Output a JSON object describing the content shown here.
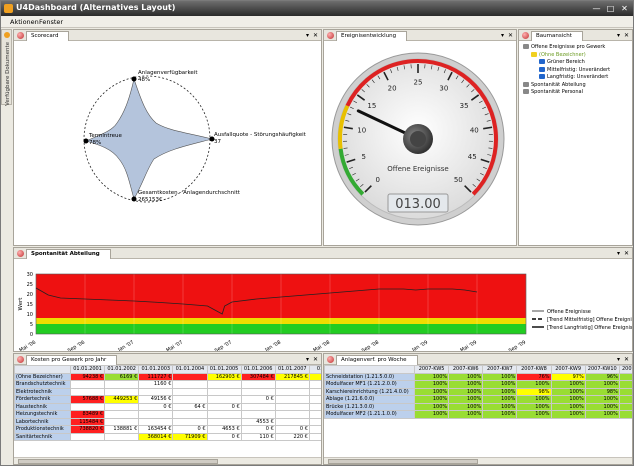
{
  "window": {
    "title": "U4Dashboard (Alternatives Layout)"
  },
  "menu": [
    "Aktionen",
    "Fenster"
  ],
  "sidetab": {
    "label": "Verfügbare Dokumente"
  },
  "scorecard": {
    "tab": "Scorecard",
    "labels": [
      {
        "name": "Anlagenverfügbarkeit",
        "value": "48%"
      },
      {
        "name": "Ausfallquote - Störungshäufigkeit",
        "value": "37"
      },
      {
        "name": "Gesamtkosten - Anlagendurchschnitt",
        "value": "265153€"
      },
      {
        "name": "Termintreue",
        "value": "78%"
      }
    ]
  },
  "gauge": {
    "tab": "Ereignisentwicklung",
    "label": "Offene Ereignisse",
    "readout": "013.00",
    "ticks": [
      "0",
      "5",
      "10",
      "15",
      "20",
      "25",
      "30",
      "35",
      "40",
      "45",
      "50"
    ],
    "value": 13,
    "min": 0,
    "max": 50,
    "colors": {
      "green": "#33aa33",
      "yellow": "#e8c000",
      "red": "#dd2222"
    }
  },
  "tree": {
    "tab": "Baumansicht",
    "items": [
      {
        "label": "Offene Ereignisse pro Gewerk",
        "level": 0
      },
      {
        "label": "(Ohne Bezeichner)",
        "level": 1,
        "selected": true
      },
      {
        "label": "Grüner Bereich",
        "level": 2
      },
      {
        "label": "Mittelfristig: Unverändert",
        "level": 2
      },
      {
        "label": "Langfristig: Unverändert",
        "level": 2
      },
      {
        "label": "Spontanität Abteilung",
        "level": 0
      },
      {
        "label": "Spontanität Personal",
        "level": 0
      }
    ]
  },
  "spontan": {
    "tab": "Spontanität Abteilung",
    "legend": [
      "Offene Ereignisse",
      "[Trend Mittelfristig] Offene Ereignisse",
      "[Trend Langfristig] Offene Ereignisse"
    ]
  },
  "chart_data": {
    "type": "line",
    "ylabel": "Wert",
    "ylim": [
      0,
      30
    ],
    "yticks": [
      "0",
      "5",
      "10",
      "15",
      "20",
      "25",
      "30"
    ],
    "categories": [
      "Mai '06",
      "Jul '06",
      "Sep '06",
      "Nov '06",
      "Jan '07",
      "Mär '07",
      "Mai '07",
      "Jul '07",
      "Sep '07",
      "Nov '07",
      "Jan '08",
      "Mär '08",
      "Mai '08",
      "Jul '08",
      "Sep '08",
      "Nov '08",
      "Jan '09",
      "Mär '09",
      "Mai '09",
      "Jul '09",
      "Sep '09"
    ],
    "bands": [
      {
        "from": 0,
        "to": 5,
        "color": "#22cc22"
      },
      {
        "from": 5,
        "to": 8,
        "color": "#eedd00"
      },
      {
        "from": 8,
        "to": 30,
        "color": "#ee1111"
      }
    ],
    "series": [
      {
        "name": "Offene Ereignisse",
        "x": [
          0,
          0.5,
          1,
          2,
          3,
          4,
          5,
          6,
          7,
          7.6,
          7.7,
          8,
          9,
          10,
          11,
          12,
          13,
          14,
          15,
          15.5,
          16,
          17,
          17.5,
          18
        ],
        "values": [
          23,
          19.5,
          18,
          17.5,
          17,
          16.5,
          15.8,
          15,
          14,
          10,
          14,
          16,
          17.5,
          18.5,
          19.5,
          20.5,
          21.5,
          22.5,
          22.5,
          22,
          22.5,
          22.5,
          22,
          21
        ]
      }
    ]
  },
  "kosten": {
    "tab": "Kosten pro Gewerk pro Jahr",
    "columns": [
      "01.01.2001",
      "01.01.2002",
      "01.01.2003",
      "01.01.2004",
      "01.01.2005",
      "01.01.2006",
      "01.01.2007",
      "01.01.2"
    ],
    "rows": [
      {
        "label": "(Ohne Bezeichner)",
        "cells": [
          [
            "94238 €",
            "r"
          ],
          [
            "6169 €",
            "g"
          ],
          [
            "111727 €",
            "r"
          ],
          [
            "",
            "r"
          ],
          [
            "162903 €",
            "y"
          ],
          [
            "307484 €",
            "r"
          ],
          [
            "217845 €",
            "y"
          ],
          [
            "2 3",
            "y"
          ]
        ]
      },
      {
        "label": "Brandschutztechnik",
        "cells": [
          [
            "",
            "w"
          ],
          [
            "",
            "w"
          ],
          [
            "1160 €",
            "w"
          ],
          [
            "",
            "w"
          ],
          [
            "",
            "w"
          ],
          [
            "",
            "w"
          ],
          [
            "",
            "w"
          ],
          [
            "",
            "w"
          ]
        ]
      },
      {
        "label": "Elektrotechnik",
        "cells": [
          [
            "",
            "w"
          ],
          [
            "",
            "w"
          ],
          [
            "",
            "w"
          ],
          [
            "",
            "w"
          ],
          [
            "",
            "w"
          ],
          [
            "",
            "w"
          ],
          [
            "",
            "w"
          ],
          [
            "",
            "w"
          ]
        ]
      },
      {
        "label": "Fördertechnik",
        "cells": [
          [
            "57688 €",
            "r"
          ],
          [
            "449253 €",
            "y"
          ],
          [
            "49156 €",
            "w"
          ],
          [
            "",
            "w"
          ],
          [
            "",
            "w"
          ],
          [
            "0 €",
            "w"
          ],
          [
            "",
            "w"
          ],
          [
            "",
            "w"
          ]
        ]
      },
      {
        "label": "Haustechnik",
        "cells": [
          [
            "",
            "w"
          ],
          [
            "",
            "w"
          ],
          [
            "0 €",
            "w"
          ],
          [
            "64 €",
            "w"
          ],
          [
            "0 €",
            "w"
          ],
          [
            "",
            "w"
          ],
          [
            "",
            "w"
          ],
          [
            "",
            "w"
          ]
        ]
      },
      {
        "label": "Heizungstechnik",
        "cells": [
          [
            "83489 €",
            "r"
          ],
          [
            "",
            "w"
          ],
          [
            "",
            "w"
          ],
          [
            "",
            "w"
          ],
          [
            "",
            "w"
          ],
          [
            "",
            "w"
          ],
          [
            "",
            "w"
          ],
          [
            "",
            "w"
          ]
        ]
      },
      {
        "label": "Labortechnik",
        "cells": [
          [
            "115484 €",
            "r"
          ],
          [
            "",
            "w"
          ],
          [
            "",
            "w"
          ],
          [
            "",
            "w"
          ],
          [
            "",
            "w"
          ],
          [
            "4553 €",
            "w"
          ],
          [
            "",
            "w"
          ],
          [
            "",
            "w"
          ]
        ]
      },
      {
        "label": "Produktionstechnik",
        "cells": [
          [
            "738820 €",
            "r"
          ],
          [
            "138881 €",
            "w"
          ],
          [
            "163454 €",
            "w"
          ],
          [
            "0 €",
            "w"
          ],
          [
            "4653 €",
            "w"
          ],
          [
            "0 €",
            "w"
          ],
          [
            "0 €",
            "w"
          ],
          [
            "27",
            "w"
          ]
        ]
      },
      {
        "label": "Sanitärtechnik",
        "cells": [
          [
            "",
            "w"
          ],
          [
            "",
            "w"
          ],
          [
            "368014 €",
            "y"
          ],
          [
            "71909 €",
            "y"
          ],
          [
            "0 €",
            "w"
          ],
          [
            "110 €",
            "w"
          ],
          [
            "220 €",
            "w"
          ],
          [
            "45",
            "w"
          ]
        ]
      }
    ]
  },
  "anlagen": {
    "tab": "Anlagenverf. pro Woche",
    "columns": [
      "2007-KW5",
      "2007-KW6",
      "2007-KW7",
      "2007-KW8",
      "2007-KW9",
      "2007-KW10",
      "2007-KW11"
    ],
    "rows": [
      {
        "label": "Schneidstation (1.21.5.0.0)",
        "cells": [
          [
            "100%",
            "g"
          ],
          [
            "100%",
            "g"
          ],
          [
            "100%",
            "g"
          ],
          [
            "76%",
            "r"
          ],
          [
            "97%",
            "y"
          ],
          [
            "96%",
            "g"
          ],
          [
            "100%",
            "g"
          ]
        ]
      },
      {
        "label": "Modulfacer MF1 (1.21.2.0.0)",
        "cells": [
          [
            "100%",
            "g"
          ],
          [
            "100%",
            "g"
          ],
          [
            "100%",
            "g"
          ],
          [
            "100%",
            "g"
          ],
          [
            "100%",
            "g"
          ],
          [
            "100%",
            "g"
          ],
          [
            "100%",
            "g"
          ]
        ]
      },
      {
        "label": "Karschiereinrichtung (1.21.4.0.0)",
        "cells": [
          [
            "100%",
            "g"
          ],
          [
            "100%",
            "g"
          ],
          [
            "100%",
            "g"
          ],
          [
            "98%",
            "y"
          ],
          [
            "100%",
            "g"
          ],
          [
            "98%",
            "g"
          ],
          [
            "100%",
            "g"
          ]
        ]
      },
      {
        "label": "Ablage (1.21.6.0.0)",
        "cells": [
          [
            "100%",
            "g"
          ],
          [
            "100%",
            "g"
          ],
          [
            "100%",
            "g"
          ],
          [
            "100%",
            "g"
          ],
          [
            "100%",
            "g"
          ],
          [
            "100%",
            "g"
          ],
          [
            "100%",
            "g"
          ]
        ]
      },
      {
        "label": "Brücke (1.21.3.0.0)",
        "cells": [
          [
            "100%",
            "g"
          ],
          [
            "100%",
            "g"
          ],
          [
            "100%",
            "g"
          ],
          [
            "100%",
            "g"
          ],
          [
            "100%",
            "g"
          ],
          [
            "100%",
            "g"
          ],
          [
            "100%",
            "g"
          ]
        ]
      },
      {
        "label": "Modulfacer MF2 (1.21.1.0.0)",
        "cells": [
          [
            "100%",
            "g"
          ],
          [
            "100%",
            "g"
          ],
          [
            "100%",
            "g"
          ],
          [
            "100%",
            "g"
          ],
          [
            "100%",
            "g"
          ],
          [
            "100%",
            "g"
          ],
          [
            "100%",
            "g"
          ]
        ]
      }
    ]
  }
}
